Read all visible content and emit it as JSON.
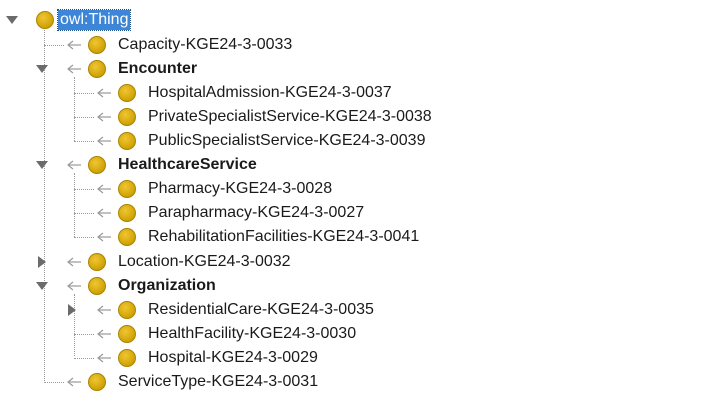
{
  "tree": {
    "root": {
      "label": "owl:Thing"
    },
    "nodes": {
      "capacity": "Capacity-KGE24-3-0033",
      "encounter": "Encounter",
      "hospital_admission": "HospitalAdmission-KGE24-3-0037",
      "private_specialist": "PrivateSpecialistService-KGE24-3-0038",
      "public_specialist": "PublicSpecialistService-KGE24-3-0039",
      "healthcare_service": "HealthcareService",
      "pharmacy": "Pharmacy-KGE24-3-0028",
      "parapharmacy": "Parapharmacy-KGE24-3-0027",
      "rehabilitation": "RehabilitationFacilities-KGE24-3-0041",
      "location": "Location-KGE24-3-0032",
      "organization": "Organization",
      "residential_care": "ResidentialCare-KGE24-3-0035",
      "health_facility": "HealthFacility-KGE24-3-0030",
      "hospital": "Hospital-KGE24-3-0029",
      "service_type": "ServiceType-KGE24-3-0031"
    }
  },
  "colors": {
    "class_circle": "#d4a80a",
    "selection": "#3d85d6",
    "connector": "#9a9a9a",
    "toggle": "#6b6b6b"
  },
  "icons": {
    "class": "class-circle-icon",
    "expanded": "expand-triangle-down-icon",
    "collapsed": "expand-triangle-right-icon",
    "subclass_arrow": "subclass-arrow-icon"
  }
}
